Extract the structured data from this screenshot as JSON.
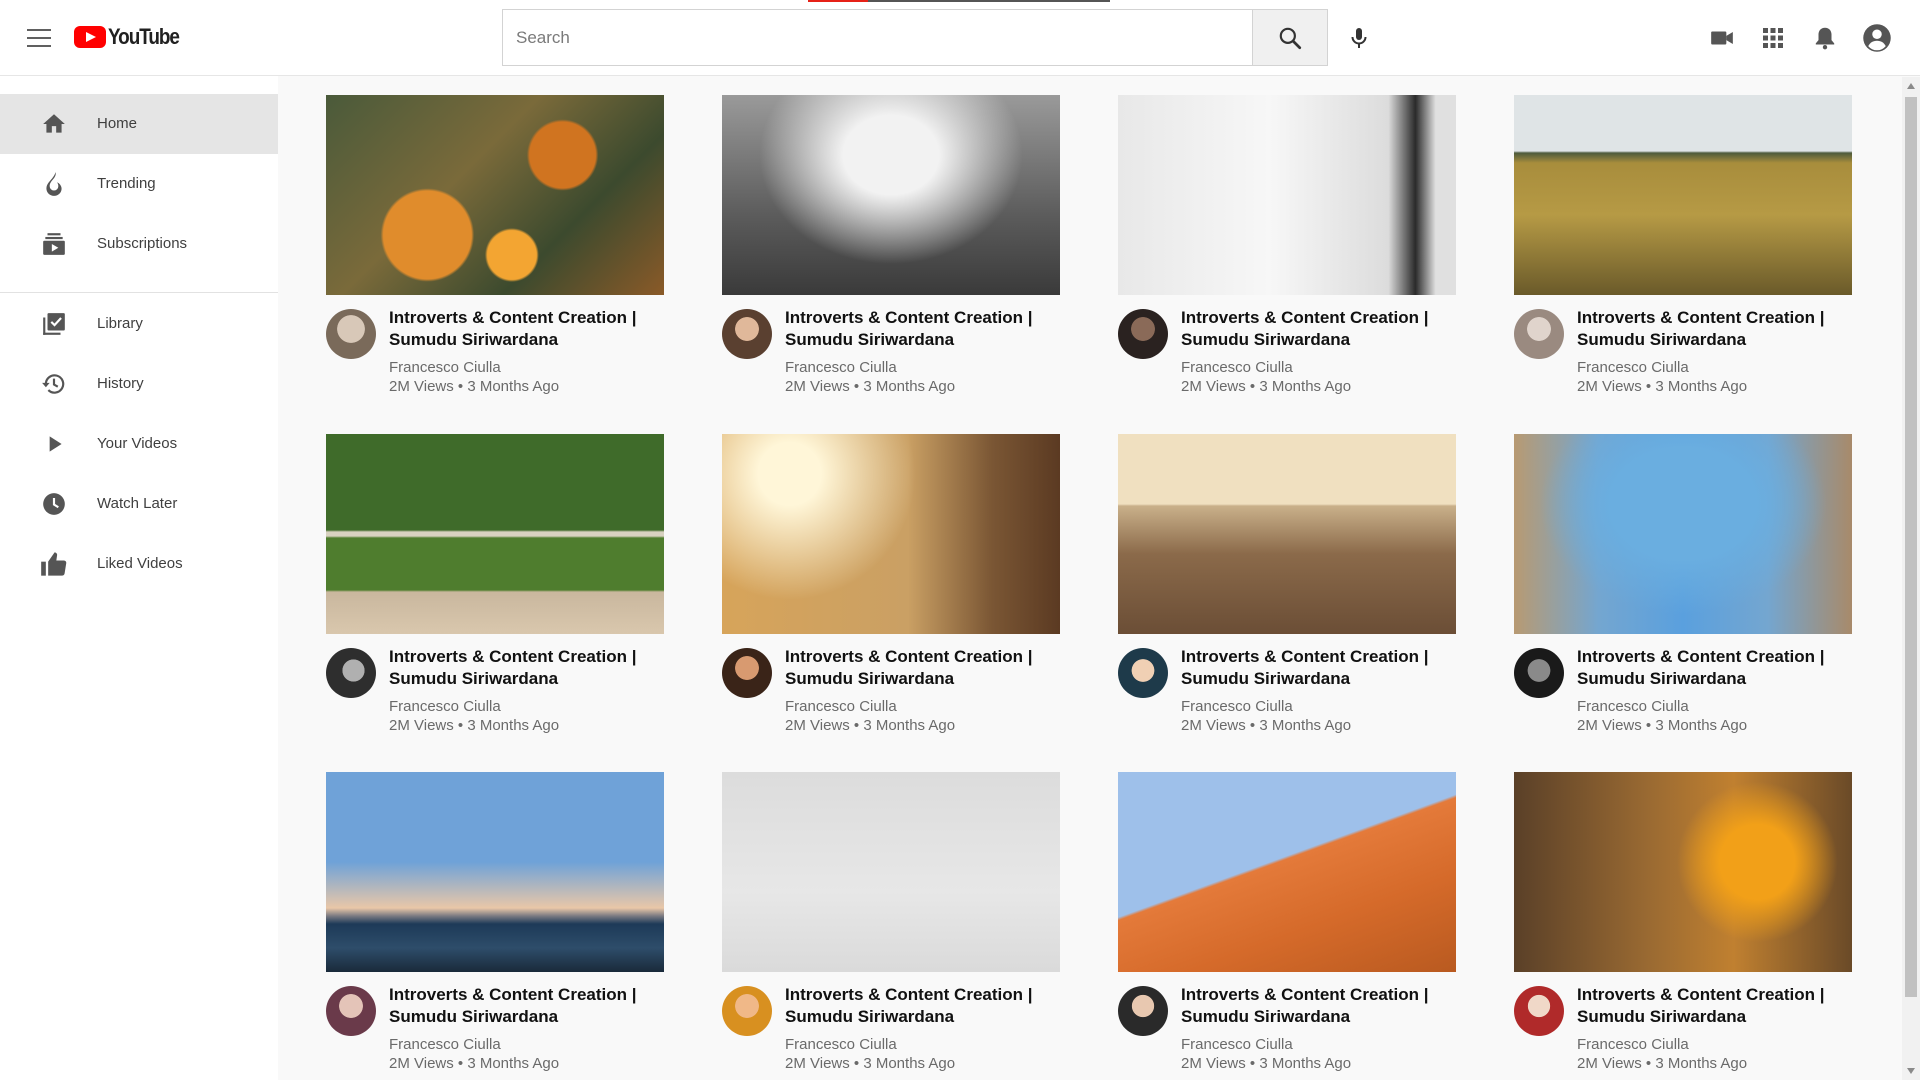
{
  "header": {
    "logo_text": "YouTube",
    "search_placeholder": "Search",
    "search_value": "",
    "brand_color": "#ff0000",
    "icons": [
      "menu-icon",
      "search-icon",
      "microphone-icon",
      "video-camera-icon",
      "apps-grid-icon",
      "notification-bell-icon",
      "account-icon"
    ]
  },
  "sidebar": {
    "items": [
      {
        "label": "Home",
        "icon": "home-icon",
        "active": true
      },
      {
        "label": "Trending",
        "icon": "flame-icon"
      },
      {
        "label": "Subscriptions",
        "icon": "subscriptions-icon"
      },
      {
        "label": "Library",
        "icon": "library-icon"
      },
      {
        "label": "History",
        "icon": "history-icon"
      },
      {
        "label": "Your Videos",
        "icon": "play-icon"
      },
      {
        "label": "Watch Later",
        "icon": "clock-icon"
      },
      {
        "label": "Liked Videos",
        "icon": "thumbs-up-icon"
      }
    ]
  },
  "videos": [
    {
      "title": "Introverts & Content Creation | Sumudu Siriwardana",
      "channel": "Francesco Ciulla",
      "meta": "2M Views • 3 Months Ago"
    },
    {
      "title": "Introverts & Content Creation | Sumudu Siriwardana",
      "channel": "Francesco Ciulla",
      "meta": "2M Views • 3 Months Ago"
    },
    {
      "title": "Introverts & Content Creation | Sumudu Siriwardana",
      "channel": "Francesco Ciulla",
      "meta": "2M Views • 3 Months Ago"
    },
    {
      "title": "Introverts & Content Creation | Sumudu Siriwardana",
      "channel": "Francesco Ciulla",
      "meta": "2M Views • 3 Months Ago"
    },
    {
      "title": "Introverts & Content Creation | Sumudu Siriwardana",
      "channel": "Francesco Ciulla",
      "meta": "2M Views • 3 Months Ago"
    },
    {
      "title": "Introverts & Content Creation | Sumudu Siriwardana",
      "channel": "Francesco Ciulla",
      "meta": "2M Views • 3 Months Ago"
    },
    {
      "title": "Introverts & Content Creation | Sumudu Siriwardana",
      "channel": "Francesco Ciulla",
      "meta": "2M Views • 3 Months Ago"
    },
    {
      "title": "Introverts & Content Creation | Sumudu Siriwardana",
      "channel": "Francesco Ciulla",
      "meta": "2M Views • 3 Months Ago"
    },
    {
      "title": "Introverts & Content Creation | Sumudu Siriwardana",
      "channel": "Francesco Ciulla",
      "meta": "2M Views • 3 Months Ago"
    },
    {
      "title": "Introverts & Content Creation | Sumudu Siriwardana",
      "channel": "Francesco Ciulla",
      "meta": "2M Views • 3 Months Ago"
    },
    {
      "title": "Introverts & Content Creation | Sumudu Siriwardana",
      "channel": "Francesco Ciulla",
      "meta": "2M Views • 3 Months Ago"
    },
    {
      "title": "Introverts & Content Creation | Sumudu Siriwardana",
      "channel": "Francesco Ciulla",
      "meta": "2M Views • 3 Months Ago"
    }
  ]
}
